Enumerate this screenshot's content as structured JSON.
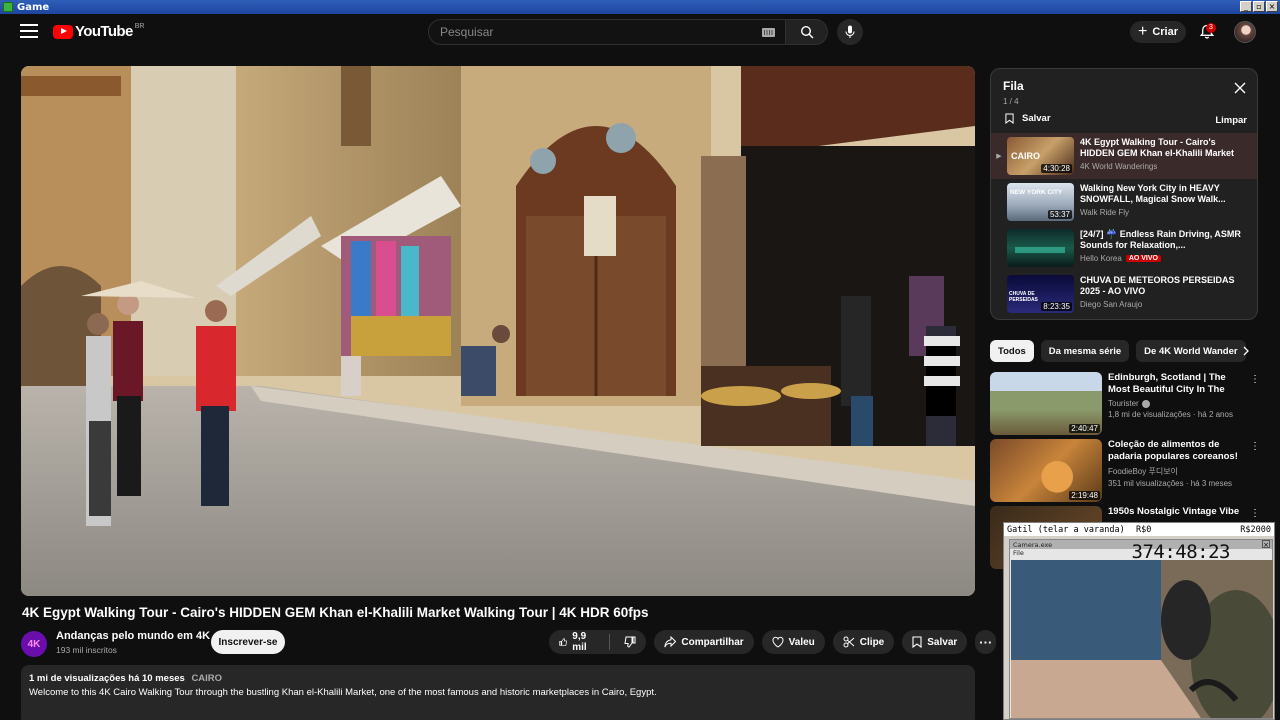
{
  "window": {
    "title": "Game"
  },
  "header": {
    "logo_text": "YouTube",
    "country": "BR",
    "search_placeholder": "Pesquisar",
    "create_label": "Criar",
    "notification_count": "3"
  },
  "video": {
    "title": "4K Egypt Walking Tour - Cairo's HIDDEN GEM Khan el-Khalili Market Walking Tour | 4K HDR 60fps",
    "channel": {
      "avatar_text": "4K",
      "name": "Andanças pelo mundo em 4K",
      "subscribers": "193 mil inscritos"
    },
    "subscribe_label": "Inscrever-se",
    "likes": "9,9 mil",
    "share_label": "Compartilhar",
    "thanks_label": "Valeu",
    "clip_label": "Clipe",
    "save_label": "Salvar",
    "more_label": "···"
  },
  "description": {
    "views": "1 mi de visualizações",
    "age": "há 10 meses",
    "tag": "CAIRO",
    "text": "Welcome to this 4K Cairo Walking Tour through the bustling Khan el-Khalili Market, one of the most famous and historic marketplaces in Cairo, Egypt."
  },
  "queue": {
    "title": "Fila",
    "count": "1 / 4",
    "save_label": "Salvar",
    "clear_label": "Limpar",
    "items": [
      {
        "marker": "▶",
        "title": "4K Egypt Walking Tour - Cairo's HIDDEN GEM Khan el-Khalili Market Walking...",
        "channel": "4K World Wanderings",
        "duration": "4:30:28",
        "thumb_text": "CAIRO"
      },
      {
        "marker": "",
        "title": "Walking New York City in HEAVY SNOWFALL, Magical Snow Walk...",
        "channel": "Walk Ride Fly",
        "duration": "53:37",
        "thumb_text": "NEW YORK CITY"
      },
      {
        "marker": "",
        "title": "[24/7] ☔ Endless Rain Driving, ASMR Sounds for Relaxation,...",
        "channel": "Hello Korea",
        "live_label": "AO VIVO",
        "duration": "",
        "thumb_text": ""
      },
      {
        "marker": "",
        "title": "CHUVA DE METEOROS PERSEIDAS 2025 - AO VIVO",
        "channel": "Diego San Araujo",
        "duration": "8:23:35",
        "thumb_text": "CHUVA DE PERSEIDAS"
      }
    ]
  },
  "chips": [
    "Todos",
    "Da mesma série",
    "De 4K World Wander"
  ],
  "recommended": [
    {
      "title": "Edinburgh, Scotland | The Most Beautiful City In The World | ...",
      "channel": "Tourister",
      "meta": "1,8 mi de visualizações · há 2 anos",
      "duration": "2:40:47"
    },
    {
      "title": "Coleção de alimentos de padaria populares coreanos!",
      "channel": "FoodieBoy 푸디보이",
      "meta": "351 mil visualizações · há 3 meses",
      "duration": "2:19:48"
    },
    {
      "title": "1950s Nostalgic Vintage Vibe",
      "channel": "",
      "meta": "",
      "duration": ""
    }
  ],
  "overlay": {
    "strip": {
      "label": "Gatil (telar a varanda)",
      "value1": "R$0",
      "value2": "R$2000"
    },
    "app_title": "Camera.exe",
    "menu": "File",
    "timer": "374:48:23"
  },
  "colors": {
    "accent": "#ff0000",
    "live": "#cc0000",
    "background": "#0f0f0f"
  }
}
